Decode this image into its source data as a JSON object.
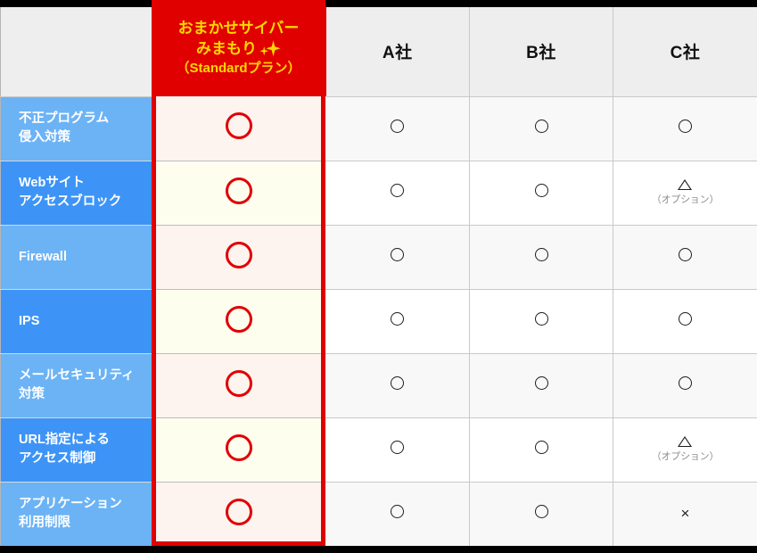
{
  "table": {
    "columns": [
      {
        "id": "feature",
        "label": ""
      },
      {
        "id": "hero",
        "label_line1": "おまかせサイバー",
        "label_line2": "みまもり",
        "label_line3": "（Standardプラン）",
        "sparkle": "sparkle-icon",
        "highlight_color": "#e00000",
        "text_color": "#ffd800"
      },
      {
        "id": "a",
        "label": "A社"
      },
      {
        "id": "b",
        "label": "B社"
      },
      {
        "id": "c",
        "label": "C社"
      }
    ],
    "rows": [
      {
        "feature_line1": "不正プログラム",
        "feature_line2": "侵入対策",
        "hero": {
          "mark": "circle-red"
        },
        "a": {
          "mark": "circle"
        },
        "b": {
          "mark": "circle"
        },
        "c": {
          "mark": "circle"
        }
      },
      {
        "feature_line1": "Webサイト",
        "feature_line2": "アクセスブロック",
        "hero": {
          "mark": "circle-red"
        },
        "a": {
          "mark": "circle"
        },
        "b": {
          "mark": "circle"
        },
        "c": {
          "mark": "triangle",
          "note": "（オプション）"
        }
      },
      {
        "feature_line1": "Firewall",
        "feature_line2": "",
        "hero": {
          "mark": "circle-red"
        },
        "a": {
          "mark": "circle"
        },
        "b": {
          "mark": "circle"
        },
        "c": {
          "mark": "circle"
        }
      },
      {
        "feature_line1": "IPS",
        "feature_line2": "",
        "hero": {
          "mark": "circle-red"
        },
        "a": {
          "mark": "circle"
        },
        "b": {
          "mark": "circle"
        },
        "c": {
          "mark": "circle"
        }
      },
      {
        "feature_line1": "メールセキュリティ",
        "feature_line2": "対策",
        "hero": {
          "mark": "circle-red"
        },
        "a": {
          "mark": "circle"
        },
        "b": {
          "mark": "circle"
        },
        "c": {
          "mark": "circle"
        }
      },
      {
        "feature_line1": "URL指定による",
        "feature_line2": "アクセス制御",
        "hero": {
          "mark": "circle-red"
        },
        "a": {
          "mark": "circle"
        },
        "b": {
          "mark": "circle"
        },
        "c": {
          "mark": "triangle",
          "note": "（オプション）"
        }
      },
      {
        "feature_line1": "アプリケーション",
        "feature_line2": "利用制限",
        "hero": {
          "mark": "circle-red"
        },
        "a": {
          "mark": "circle"
        },
        "b": {
          "mark": "circle"
        },
        "c": {
          "mark": "cross"
        }
      }
    ],
    "colors": {
      "row_label_odd": "#6cb3f5",
      "row_label_even": "#3d94f6",
      "hero_cell_odd": "#fdf3ef",
      "hero_cell_even": "#fefeef",
      "comp_cell_odd": "#f8f8f8",
      "comp_cell_even": "#ffffff",
      "header_bg": "#eeeeee",
      "frame": "#000000"
    },
    "mark_glyphs": {
      "cross": "×"
    }
  }
}
